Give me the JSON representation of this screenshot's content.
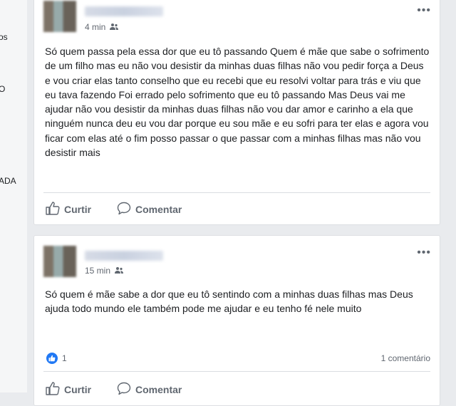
{
  "left_sidebar": {
    "fragments": [
      "os",
      "O",
      "ADA"
    ]
  },
  "posts": [
    {
      "time": "4 min",
      "audience_icon": "friends-icon",
      "text": "Só quem passa pela essa dor que eu tô passando Quem é mãe que sabe o sofrimento de um filho mas eu não vou desistir da minhas duas filhas não vou pedir força a Deus e vou criar elas tanto conselho que eu recebi que eu resolvi voltar para trás e viu que eu tava fazendo Foi errado pelo sofrimento que eu tô passando Mas Deus vai me ajudar não vou desistir da minhas duas filhas não vou dar amor e carinho a ela que ninguém nunca deu eu vou dar porque eu sou mãe e eu sofri para ter elas e agora vou ficar com elas até o fim posso passar o que passar com a minhas filhas mas não vou desistir mais",
      "actions": {
        "like": "Curtir",
        "comment": "Comentar"
      }
    },
    {
      "time": "15 min",
      "audience_icon": "friends-icon",
      "text": "Só quem é mãe sabe a dor que eu tô sentindo com a minhas duas filhas mas Deus ajuda todo mundo ele também pode me ajudar e eu tenho fé nele muito",
      "reaction_count": "1",
      "comment_count": "1 comentário",
      "actions": {
        "like": "Curtir",
        "comment": "Comentar"
      }
    }
  ],
  "colors": {
    "background": "#e9ebee",
    "card": "#ffffff",
    "like_blue": "#2078f4",
    "muted_text": "#606770"
  }
}
